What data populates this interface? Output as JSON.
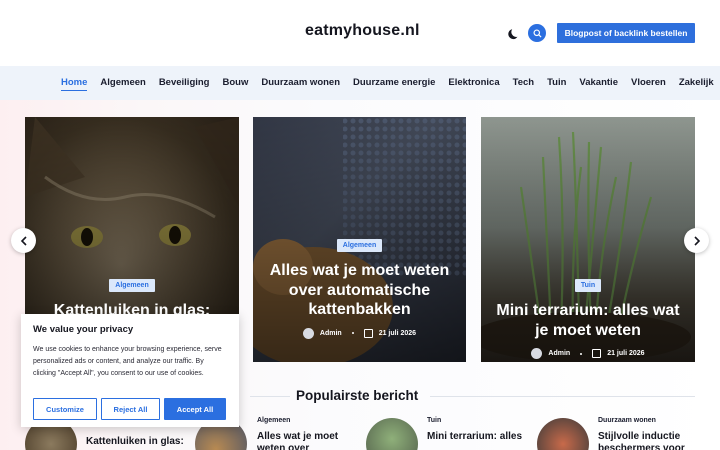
{
  "header": {
    "logo": "eatmyhouse.nl",
    "cta_label": "Blogpost of backlink bestellen",
    "icons": [
      "moon-icon",
      "search-icon"
    ]
  },
  "nav": {
    "items": [
      {
        "label": "Home",
        "active": true
      },
      {
        "label": "Algemeen"
      },
      {
        "label": "Beveiliging"
      },
      {
        "label": "Bouw"
      },
      {
        "label": "Duurzaam wonen"
      },
      {
        "label": "Duurzame energie"
      },
      {
        "label": "Elektronica"
      },
      {
        "label": "Tech"
      },
      {
        "label": "Tuin"
      },
      {
        "label": "Vakantie"
      },
      {
        "label": "Vloeren"
      },
      {
        "label": "Zakelijk"
      }
    ]
  },
  "slider": {
    "slides": [
      {
        "category": "Algemeen",
        "title": "Kattenluiken in glas:"
      },
      {
        "category": "Algemeen",
        "title": "Alles wat je moet weten over automatische kattenbakken",
        "author": "Admin",
        "date": "21 juli 2026"
      },
      {
        "category": "Tuin",
        "title": "Mini terrarium: alles wat je moet weten",
        "author": "Admin",
        "date": "21 juli 2026"
      }
    ]
  },
  "cookie": {
    "title": "We value your privacy",
    "text": "We use cookies to enhance your browsing experience, serve personalized ads or content, and analyze our traffic. By clicking \"Accept All\", you consent to our use of cookies.",
    "customize": "Customize",
    "reject": "Reject All",
    "accept": "Accept All"
  },
  "popular": {
    "heading": "Populairste bericht",
    "items": [
      {
        "category": "",
        "title": "Kattenluiken in glas:"
      },
      {
        "category": "Algemeen",
        "title": "Alles wat je moet weten over"
      },
      {
        "category": "Tuin",
        "title": "Mini terrarium: alles"
      },
      {
        "category": "Duurzaam wonen",
        "title": "Stijlvolle inductie beschermers voor"
      }
    ]
  },
  "colors": {
    "accent": "#2b6fe0",
    "nav_bg": "#eef3fa"
  }
}
